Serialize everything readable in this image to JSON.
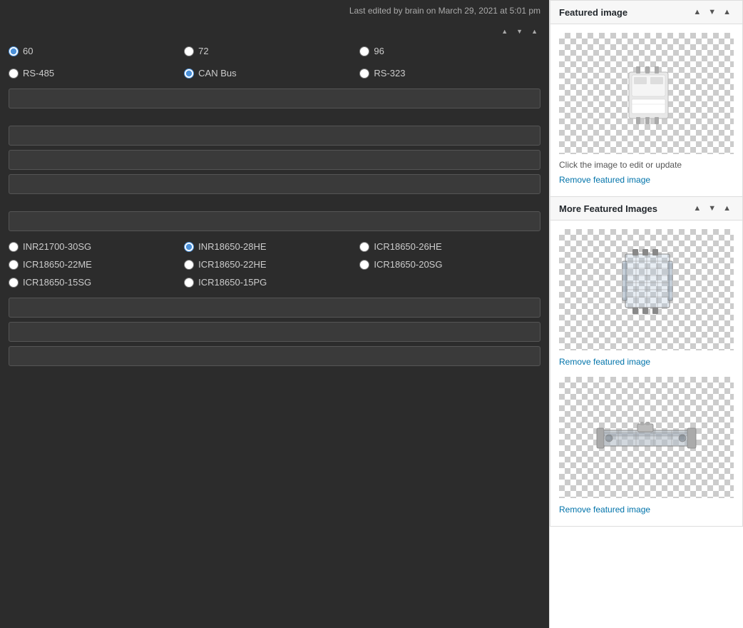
{
  "main": {
    "last_edited": "Last edited by brain on March 29, 2021 at 5:01 pm",
    "radio_group_1": {
      "options": [
        {
          "label": "60",
          "value": "60",
          "checked": true
        },
        {
          "label": "72",
          "value": "72",
          "checked": false
        },
        {
          "label": "96",
          "value": "96",
          "checked": false
        }
      ]
    },
    "radio_group_2": {
      "options": [
        {
          "label": "RS-485",
          "value": "RS-485",
          "checked": false
        },
        {
          "label": "CAN Bus",
          "value": "CAN Bus",
          "checked": true
        },
        {
          "label": "RS-323",
          "value": "RS-323",
          "checked": false
        }
      ]
    },
    "radio_group_3": {
      "options": [
        {
          "label": "INR21700-30SG",
          "value": "INR21700-30SG",
          "checked": false
        },
        {
          "label": "INR18650-28HE",
          "value": "INR18650-28HE",
          "checked": true
        },
        {
          "label": "ICR18650-26HE",
          "value": "ICR18650-26HE",
          "checked": false
        },
        {
          "label": "ICR18650-22ME",
          "value": "ICR18650-22ME",
          "checked": false
        },
        {
          "label": "ICR18650-22HE",
          "value": "ICR18650-22HE",
          "checked": false
        },
        {
          "label": "ICR18650-20SG",
          "value": "ICR18650-20SG",
          "checked": false
        },
        {
          "label": "ICR18650-15SG",
          "value": "ICR18650-15SG",
          "checked": false
        },
        {
          "label": "ICR18650-15PG",
          "value": "ICR18650-15PG",
          "checked": false
        }
      ]
    }
  },
  "sidebar": {
    "featured_image": {
      "panel_title": "Featured image",
      "click_hint": "Click the image to edit or update",
      "remove_label": "Remove featured image"
    },
    "more_featured_images": {
      "panel_title": "More Featured Images",
      "images": [
        {
          "remove_label": "Remove featured image"
        },
        {
          "remove_label": "Remove featured image"
        }
      ]
    }
  },
  "controls": {
    "arrow_up": "▲",
    "arrow_down": "▼",
    "collapse": "▲"
  }
}
